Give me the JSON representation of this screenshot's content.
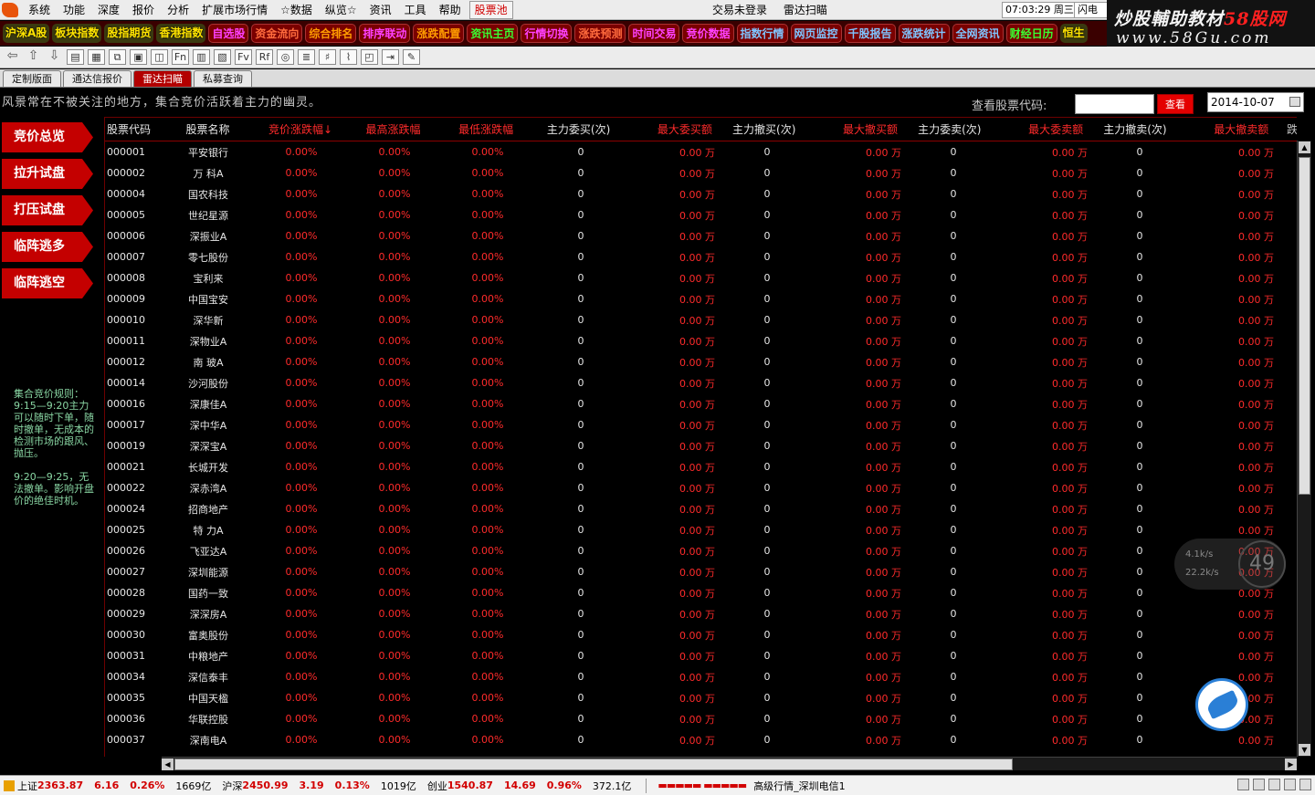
{
  "menu": {
    "items": [
      "系统",
      "功能",
      "深度",
      "报价",
      "分析",
      "扩展市场行情",
      "☆数据",
      "纵览☆",
      "资讯",
      "工具",
      "帮助"
    ],
    "active": "股票池",
    "trade_status": "交易未登录",
    "radar": "雷达扫瞄",
    "clock": "07:03:29 周三",
    "flash": "闪电手"
  },
  "watermark": {
    "line1a": "炒股輔助教材",
    "line1b": "58股网",
    "line2": "www.58Gu.com"
  },
  "quickbar": [
    {
      "label": "沪深A股",
      "style": "gold"
    },
    {
      "label": "板块指数",
      "style": "gold"
    },
    {
      "label": "股指期货",
      "style": "gold"
    },
    {
      "label": "香港指数",
      "style": "gold"
    },
    {
      "label": "自选股",
      "style": "purple"
    },
    {
      "label": "资金流向",
      "style": "red"
    },
    {
      "label": "综合排名",
      "style": "orange"
    },
    {
      "label": "排序联动",
      "style": "purple"
    },
    {
      "label": "涨跌配置",
      "style": "orange"
    },
    {
      "label": "资讯主页",
      "style": "green"
    },
    {
      "label": "行情切换",
      "style": "purple"
    },
    {
      "label": "涨跌预测",
      "style": "red"
    },
    {
      "label": "时间交易",
      "style": "purple"
    },
    {
      "label": "竞价数据",
      "style": "purple"
    },
    {
      "label": "指数行情",
      "style": "blue"
    },
    {
      "label": "网页监控",
      "style": "blue"
    },
    {
      "label": "千股报告",
      "style": "blue"
    },
    {
      "label": "涨跌统计",
      "style": "blue"
    },
    {
      "label": "全网资讯",
      "style": "blue"
    },
    {
      "label": "财经日历",
      "style": "green"
    },
    {
      "label": "恒生",
      "style": "gold"
    }
  ],
  "toolbar": [
    "⇦",
    "⇧",
    "⇩",
    "▤",
    "▦",
    "⧉",
    "▣",
    "◫",
    "Fn",
    "▥",
    "▧",
    "Fv",
    "Rf",
    "◎",
    "≣",
    "♯",
    "⌇",
    "◰",
    "⇥",
    "✎"
  ],
  "tabs": [
    {
      "label": "定制版面",
      "active": false
    },
    {
      "label": "通达信报价",
      "active": false
    },
    {
      "label": "雷达扫瞄",
      "active": true
    },
    {
      "label": "私募查询",
      "active": false
    }
  ],
  "slogan": "风景常在不被关注的地方，集合竞价活跃着主力的幽灵。",
  "lookup": {
    "label": "查看股票代码:",
    "value": "",
    "button": "查看",
    "date": "2014-10-07"
  },
  "sidebar": {
    "buttons": [
      "竞价总览",
      "拉升试盘",
      "打压试盘",
      "临阵逃多",
      "临阵逃空"
    ],
    "rules": "集合竞价规则：\n9:15—9:20主力可以随时下单，随时撤单，无成本的检测市场的跟风、抛压。\n\n9:20—9:25，无法撤单。影响开盘价的绝佳时机。"
  },
  "table": {
    "headers": [
      "股票代码",
      "股票名称",
      "竞价涨跌幅↓",
      "最高涨跌幅",
      "最低涨跌幅",
      "主力委买(次)",
      "最大委买额",
      "主力撤买(次)",
      "最大撤买额",
      "主力委卖(次)",
      "最大委卖额",
      "主力撤卖(次)",
      "最大撤卖额",
      "跌"
    ],
    "rows": [
      [
        "000001",
        "平安银行"
      ],
      [
        "000002",
        "万 科A"
      ],
      [
        "000004",
        "国农科技"
      ],
      [
        "000005",
        "世纪星源"
      ],
      [
        "000006",
        "深振业A"
      ],
      [
        "000007",
        "零七股份"
      ],
      [
        "000008",
        "宝利来"
      ],
      [
        "000009",
        "中国宝安"
      ],
      [
        "000010",
        "深华新"
      ],
      [
        "000011",
        "深物业A"
      ],
      [
        "000012",
        "南 玻A"
      ],
      [
        "000014",
        "沙河股份"
      ],
      [
        "000016",
        "深康佳A"
      ],
      [
        "000017",
        "深中华A"
      ],
      [
        "000019",
        "深深宝A"
      ],
      [
        "000021",
        "长城开发"
      ],
      [
        "000022",
        "深赤湾A"
      ],
      [
        "000024",
        "招商地产"
      ],
      [
        "000025",
        "特 力A"
      ],
      [
        "000026",
        "飞亚达A"
      ],
      [
        "000027",
        "深圳能源"
      ],
      [
        "000028",
        "国药一致"
      ],
      [
        "000029",
        "深深房A"
      ],
      [
        "000030",
        "富奥股份"
      ],
      [
        "000031",
        "中粮地产"
      ],
      [
        "000034",
        "深信泰丰"
      ],
      [
        "000035",
        "中国天楹"
      ],
      [
        "000036",
        "华联控股"
      ],
      [
        "000037",
        "深南电A"
      ]
    ],
    "pct": "0.00%",
    "count": "0",
    "amount": "0.00 万"
  },
  "gauge": {
    "up": "4.1k/s",
    "down": "22.2k/s",
    "value": "49"
  },
  "status": {
    "sh_label": "上证",
    "sh_value": "2363.87",
    "sh_change": "6.16",
    "sh_pct": "0.26%",
    "sh_vol": "1669亿",
    "sz_label": "沪深",
    "sz_value": "2450.99",
    "sz_change": "3.19",
    "sz_pct": "0.13%",
    "sz_vol": "1019亿",
    "cy_label": "创业",
    "cy_value": "1540.87",
    "cy_change": "14.69",
    "cy_pct": "0.96%",
    "cy_vol": "372.1亿",
    "lamps": "▬▬▬▬▬ ▬▬▬▬▬",
    "server": "高级行情_深圳电信1"
  }
}
